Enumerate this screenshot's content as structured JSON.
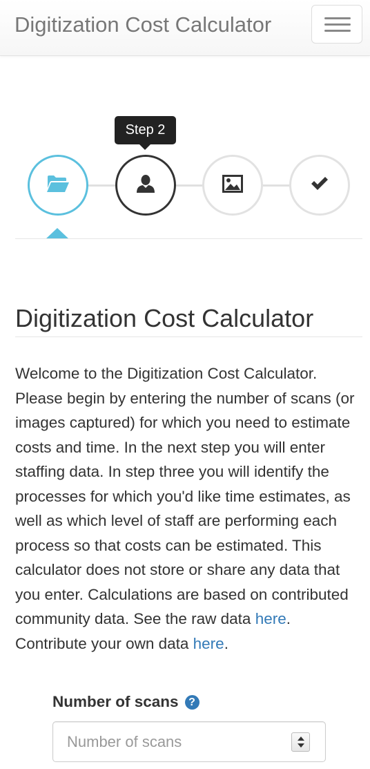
{
  "navbar": {
    "brand": "Digitization Cost Calculator",
    "toggle_icon": "hamburger-menu-icon"
  },
  "wizard": {
    "tooltip": "Step 2",
    "steps": [
      {
        "icon": "folder-open-icon",
        "state": "active"
      },
      {
        "icon": "user-icon",
        "state": "current"
      },
      {
        "icon": "image-icon",
        "state": "upcoming"
      },
      {
        "icon": "checkmark-icon",
        "state": "upcoming"
      }
    ],
    "colors": {
      "active": "#5bc0de",
      "current": "#333333",
      "upcoming": "#e2e2e2"
    }
  },
  "main": {
    "heading": "Digitization Cost Calculator",
    "intro_text": "Welcome to the Digitization Cost Calculator. Please begin by entering the number of scans (or images captured) for which you need to estimate costs and time. In the next step you will enter staffing data. In step three you will identify the processes for which you'd like time estimates, as well as which level of staff are performing each process so that costs can be estimated. This calculator does not store or share any data that you enter. Calculations are based on contributed community data. See the raw data ",
    "raw_data_link": "here",
    "after_raw_link": ".",
    "contribute_text": "Contribute your own data ",
    "contribute_link": "here",
    "after_contribute_link": ".",
    "link_color": "#337ab7"
  },
  "form": {
    "scans_label": "Number of scans",
    "help_icon": "question-circle-icon",
    "help_symbol": "?",
    "scans_placeholder": "Number of scans",
    "scans_value": ""
  }
}
